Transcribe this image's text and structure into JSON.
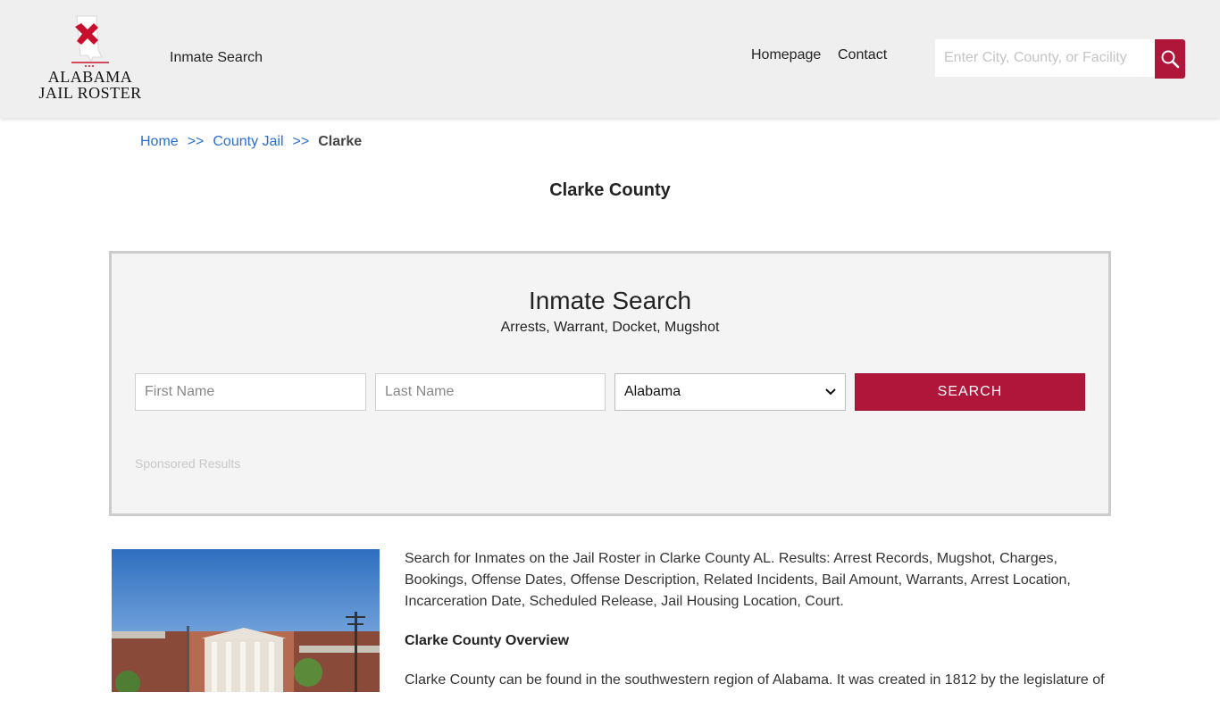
{
  "header": {
    "logo": {
      "line1": "ALABAMA",
      "line2": "JAIL ROSTER"
    },
    "nav_inmate_search": "Inmate Search",
    "nav_homepage": "Homepage",
    "nav_contact": "Contact",
    "search_placeholder": "Enter City, County, or Facility"
  },
  "breadcrumb": {
    "home": "Home",
    "sep1": ">>",
    "county_jail": "County Jail",
    "sep2": ">>",
    "current": "Clarke"
  },
  "page_title": "Clarke County",
  "search_panel": {
    "title": "Inmate Search",
    "subtitle": "Arrests, Warrant, Docket, Mugshot",
    "first_name_placeholder": "First Name",
    "last_name_placeholder": "Last Name",
    "state_selected": "Alabama",
    "button_label": "SEARCH",
    "sponsored": "Sponsored Results"
  },
  "content": {
    "intro": "Search for Inmates on the Jail Roster in Clarke County AL. Results: Arrest Records, Mugshot, Charges, Bookings, Offense Dates, Offense Description, Related Incidents, Bail Amount, Warrants, Arrest Location, Incarceration Date, Scheduled Release, Jail Housing Location, Court.",
    "overview_heading": "Clarke County Overview",
    "overview_text": "Clarke County can be found in the southwestern region of Alabama. It was created in 1812 by the legislature of"
  },
  "colors": {
    "brand": "#b0163a",
    "link": "#2a6fcf",
    "header_bg": "#efefef"
  },
  "icons": {
    "search": "search-icon",
    "dropdown": "chevron-down-icon",
    "logo": "alabama-map-icon"
  }
}
